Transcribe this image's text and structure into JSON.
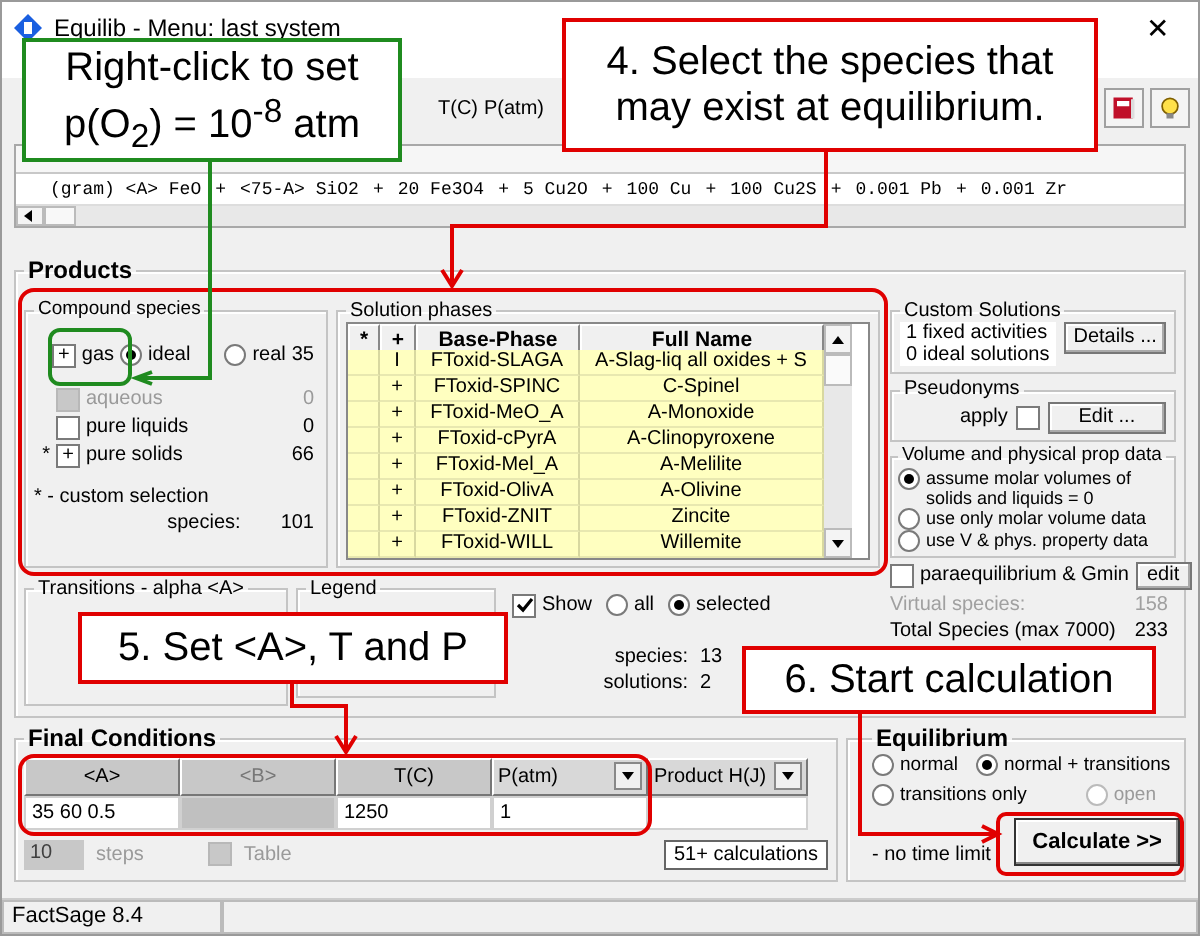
{
  "window": {
    "title": "Equilib - Menu: last system",
    "close": "✕"
  },
  "toolbar": {
    "labels": [
      "T(C)",
      "P(atm)"
    ]
  },
  "reactants": {
    "separator": "+",
    "items": [
      "(gram) <A>  FeO",
      "<75-A>  SiO2",
      "20  Fe3O4",
      "5  Cu2O",
      "100  Cu",
      "100  Cu2S",
      "0.001  Pb",
      "0.001  Zr"
    ]
  },
  "products": {
    "title": "Products",
    "compound_species": {
      "title": "Compound species",
      "check_mark": "+",
      "custom_symbol": "*",
      "rows": [
        {
          "kind": "gas",
          "label": "gas",
          "checked": true,
          "disabled": false,
          "custom": false,
          "count": "35",
          "options": [
            {
              "label": "ideal",
              "selected": true
            },
            {
              "label": "real",
              "selected": false
            }
          ]
        },
        {
          "kind": "plain",
          "label": "aqueous",
          "checked": false,
          "disabled": true,
          "custom": false,
          "count": "0"
        },
        {
          "kind": "plain",
          "label": "pure liquids",
          "checked": false,
          "disabled": false,
          "custom": false,
          "count": "0"
        },
        {
          "kind": "plain",
          "label": "pure solids",
          "checked": true,
          "disabled": false,
          "custom": true,
          "count": "66"
        }
      ],
      "note": "* - custom selection",
      "total_label": "species:",
      "total": "101"
    },
    "solution_phases": {
      "title": "Solution phases",
      "columns": [
        "*",
        "+",
        "Base-Phase",
        "Full Name"
      ],
      "rows": [
        {
          "sel": "I",
          "base": "FToxid-SLAGA",
          "full": "A-Slag-liq all oxides + S"
        },
        {
          "sel": "+",
          "base": "FToxid-SPINC",
          "full": "C-Spinel"
        },
        {
          "sel": "+",
          "base": "FToxid-MeO_A",
          "full": "A-Monoxide"
        },
        {
          "sel": "+",
          "base": "FToxid-cPyrA",
          "full": "A-Clinopyroxene"
        },
        {
          "sel": "+",
          "base": "FToxid-Mel_A",
          "full": "A-Melilite"
        },
        {
          "sel": "+",
          "base": "FToxid-OlivA",
          "full": "A-Olivine"
        },
        {
          "sel": "+",
          "base": "FToxid-ZNIT",
          "full": "Zincite"
        },
        {
          "sel": "+",
          "base": "FToxid-WILL",
          "full": "Willemite"
        }
      ]
    },
    "custom_solutions": {
      "title": "Custom Solutions",
      "lines": [
        {
          "count": "1",
          "label": "fixed activities"
        },
        {
          "count": "0",
          "label": "ideal solutions"
        }
      ],
      "button": "Details ..."
    },
    "pseudonyms": {
      "title": "Pseudonyms",
      "apply_label": "apply",
      "apply_checked": false,
      "button": "Edit ..."
    },
    "volume": {
      "title": "Volume and physical prop data",
      "options": [
        {
          "label": "assume molar volumes of solids and liquids = 0",
          "selected": true
        },
        {
          "label": "use only molar volume data",
          "selected": false
        },
        {
          "label": "use V & phys. property data",
          "selected": false
        }
      ]
    },
    "paraequilibrium": {
      "label": "paraequilibrium & Gmin",
      "checked": false,
      "button": "edit"
    },
    "virtual_species": {
      "label": "Virtual species:",
      "value": "158"
    },
    "total_species": {
      "label": "Total Species (max 7000)",
      "value": "233"
    },
    "transitions": {
      "title": "Transitions - alpha <A>"
    },
    "legend": {
      "title": "Legend"
    },
    "show": {
      "label": "Show",
      "checked": true,
      "options": [
        {
          "label": "all",
          "selected": false
        },
        {
          "label": "selected",
          "selected": true
        }
      ],
      "counts": [
        {
          "label": "species:",
          "value": "13"
        },
        {
          "label": "solutions:",
          "value": "2"
        }
      ]
    }
  },
  "final_conditions": {
    "title": "Final Conditions",
    "columns": [
      {
        "label": "<A>",
        "disabled": false,
        "dropdown": false,
        "value": "35 60 0.5"
      },
      {
        "label": "<B>",
        "disabled": true,
        "dropdown": false
      },
      {
        "label": "T(C)",
        "disabled": false,
        "dropdown": false,
        "value": "1250"
      },
      {
        "label": "P(atm)",
        "disabled": false,
        "dropdown": true,
        "value": "1"
      },
      {
        "label": "Product H(J)",
        "disabled": false,
        "dropdown": true
      }
    ],
    "steps": {
      "value": "10",
      "label": "steps",
      "disabled": true
    },
    "table": {
      "label": "Table",
      "checked": false,
      "disabled": true
    },
    "calculations": "51+ calculations"
  },
  "equilibrium": {
    "title": "Equilibrium",
    "options": [
      {
        "label": "normal",
        "selected": false,
        "disabled": false
      },
      {
        "label": "normal + transitions",
        "selected": true,
        "disabled": false
      },
      {
        "label": "transitions only",
        "selected": false,
        "disabled": false
      },
      {
        "label": "open",
        "selected": false,
        "disabled": true
      }
    ],
    "time_limit": "- no time limit",
    "calculate": "Calculate >>"
  },
  "status_bar": [
    "FactSage 8.4"
  ],
  "callouts": [
    {
      "text": "Right-click to set p(O$_{2}$) = 10$^{-8}$ atm",
      "color": "#1f8b1f"
    },
    {
      "text": "4. Select the species that may exist at equilibrium.",
      "color": "#e00000"
    },
    {
      "text": "5. Set <A>, T and P",
      "color": "#e00000"
    },
    {
      "text": "6. Start calculation",
      "color": "#e00000"
    }
  ]
}
